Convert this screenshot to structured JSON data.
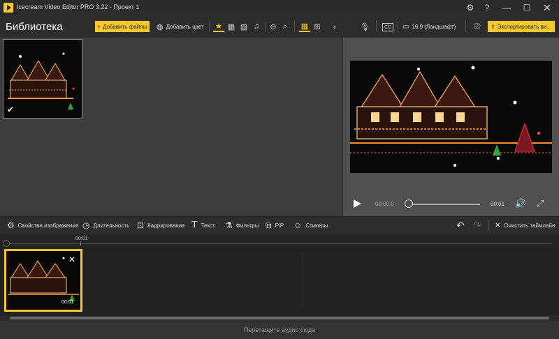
{
  "window": {
    "title": "Icecream Video Editor PRO 3.22  -  Проект 1"
  },
  "library": {
    "title": "Библиотека",
    "add_files_label": "Добавить файлы",
    "add_color_label": "Добавить цвет",
    "toolbar_icons": [
      "star-icon",
      "film-icon",
      "image-icon",
      "music-icon",
      "zoom-out-icon",
      "search-icon",
      "grid-large-icon",
      "grid-small-icon",
      "collapse-icon"
    ]
  },
  "preview": {
    "aspect_label": "16:9 (Ландшафт)",
    "export_label": "Экспортировать ви...",
    "time_current": "00:00.0",
    "time_end": "00:01",
    "progress": 0.0
  },
  "edit_toolbar": {
    "image_props": "Свойства изображения",
    "duration": "Длительность",
    "crop": "Кадрирование",
    "text": "Текст",
    "filters": "Фильтры",
    "pip": "PiP",
    "stickers": "Стикеры",
    "clear_timeline": "Очистить таймлайн"
  },
  "timeline": {
    "ruler_label": "00:01",
    "clip_duration": "00:01",
    "audio_drop_hint": "Перетащите аудио сюда"
  },
  "colors": {
    "accent": "#f6c92b",
    "library_bg": "#3d3d3d",
    "preview_bg": "#505050"
  }
}
